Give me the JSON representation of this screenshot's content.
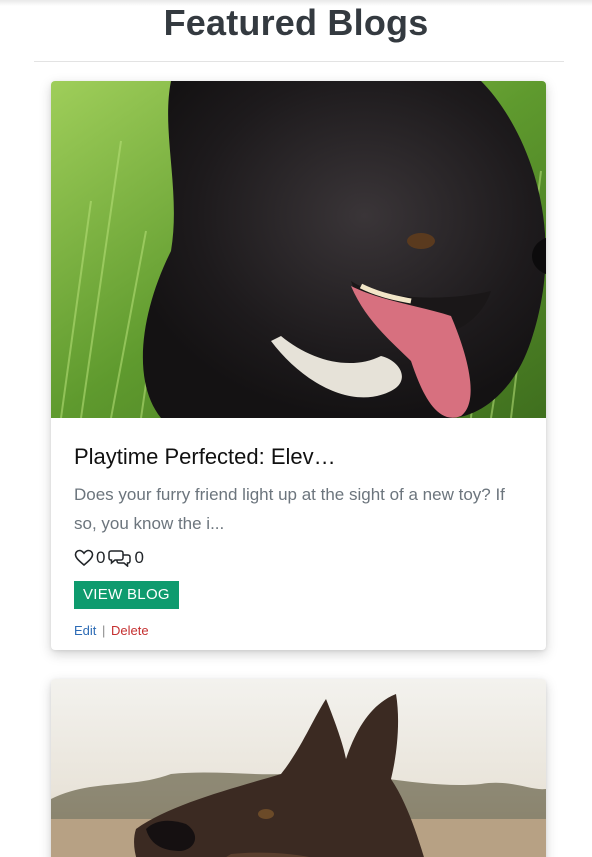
{
  "page": {
    "title": "Featured Blogs"
  },
  "blogs": [
    {
      "title": "Playtime Perfected: Elev…",
      "excerpt": "Does your furry friend light up at the sight of a new toy? If so, you know the i...",
      "likes": "0",
      "comments": "0",
      "view_label": "VIEW BLOG",
      "edit_label": "Edit",
      "separator": "|",
      "delete_label": "Delete",
      "image_alt": "black dog in grass"
    },
    {
      "image_alt": "german shepherd in field"
    }
  ],
  "icons": {
    "like": "heart-icon",
    "comment": "comments-icon"
  },
  "colors": {
    "button_bg": "#0e9b6e",
    "edit_link": "#2d6bb5",
    "delete_link": "#c53030",
    "excerpt": "#6c757d"
  }
}
